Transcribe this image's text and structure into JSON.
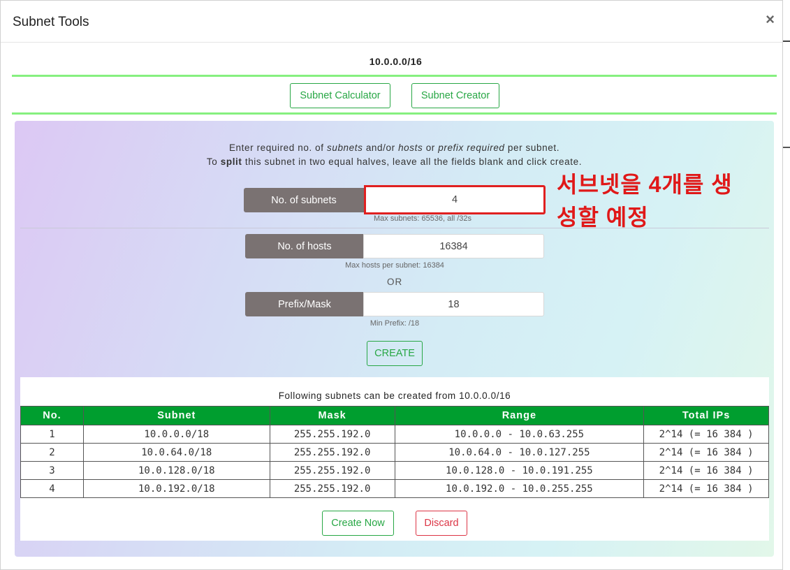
{
  "modal": {
    "title": "Subnet Tools",
    "close_symbol": "×"
  },
  "network": "10.0.0.0/16",
  "tools": {
    "calculator_label": "Subnet Calculator",
    "creator_label": "Subnet Creator"
  },
  "instructions": {
    "line1": {
      "a": "Enter required no. of ",
      "b": "subnets",
      "c": " and/or ",
      "d": "hosts",
      "e": " or ",
      "f": "prefix required",
      "g": " per subnet."
    },
    "line2": {
      "a": "To ",
      "b": "split",
      "c": " this subnet in two equal halves, leave all the fields blank and click create."
    }
  },
  "fields": {
    "subnets": {
      "label": "No. of subnets",
      "value": "4",
      "hint": "Max subnets: 65536, all /32s"
    },
    "hosts": {
      "label": "No. of hosts",
      "value": "16384",
      "hint": "Max hosts per subnet: 16384"
    },
    "or_text": "OR",
    "prefix": {
      "label": "Prefix/Mask",
      "value": "18",
      "hint": "Min Prefix: /18"
    }
  },
  "create_label": "CREATE",
  "annotation": {
    "line1": "서브넷을 4개를 생",
    "line2": "성할 예정"
  },
  "results": {
    "caption": "Following subnets can be created from 10.0.0.0/16",
    "headers": [
      "No.",
      "Subnet",
      "Mask",
      "Range",
      "Total IPs"
    ],
    "rows": [
      [
        "1",
        "10.0.0.0/18",
        "255.255.192.0",
        "10.0.0.0 - 10.0.63.255",
        "2^14 (= 16 384 )"
      ],
      [
        "2",
        "10.0.64.0/18",
        "255.255.192.0",
        "10.0.64.0 - 10.0.127.255",
        "2^14 (= 16 384 )"
      ],
      [
        "3",
        "10.0.128.0/18",
        "255.255.192.0",
        "10.0.128.0 - 10.0.191.255",
        "2^14 (= 16 384 )"
      ],
      [
        "4",
        "10.0.192.0/18",
        "255.255.192.0",
        "10.0.192.0 - 10.0.255.255",
        "2^14 (= 16 384 )"
      ]
    ],
    "create_now_label": "Create Now",
    "discard_label": "Discard"
  },
  "colors": {
    "accent_green": "#28a745",
    "header_green": "#009e2f",
    "label_gray": "#7a7272",
    "annotation_red": "#e01818",
    "discard_red": "#dc3545"
  }
}
